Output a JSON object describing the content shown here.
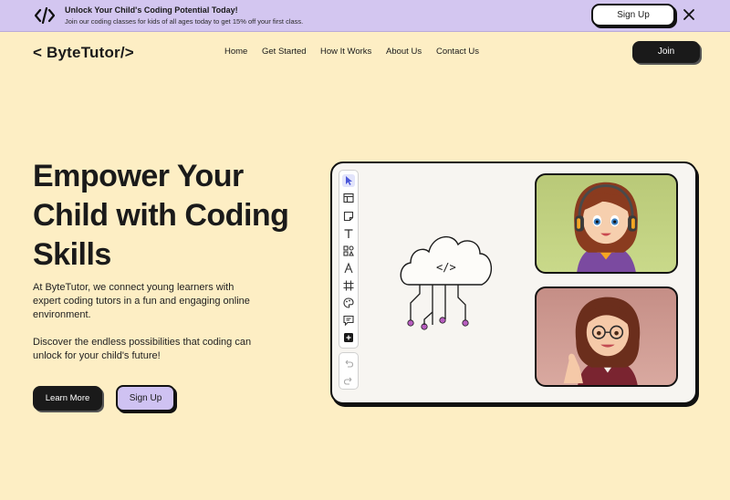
{
  "banner": {
    "icon": "code-brackets-icon",
    "title": "Unlock Your Child's Coding Potential Today!",
    "subtitle": "Join our coding classes for kids of all ages today to get 15% off your first class.",
    "signup_label": "Sign Up",
    "close_icon": "close-icon"
  },
  "header": {
    "logo": "< ByteTutor/>",
    "nav": [
      "Home",
      "Get Started",
      "How It Works",
      "About Us",
      "Contact Us"
    ],
    "join_label": "Join"
  },
  "hero": {
    "title": "Empower Your Child with Coding Skills",
    "paragraph1": "At ByteTutor, we connect young learners with expert coding tutors in a fun and engaging online environment.",
    "paragraph2": "Discover the endless possibilities that coding can unlock for your child's future!",
    "learn_more_label": "Learn More",
    "signup_label": "Sign Up"
  },
  "illustration": {
    "cloud_code": "</>",
    "tools": [
      "cursor-icon",
      "table-icon",
      "sticky-note-icon",
      "text-icon",
      "shapes-icon",
      "pen-icon",
      "frame-icon",
      "palette-icon",
      "comment-icon",
      "add-icon"
    ],
    "history_tools": [
      "undo-icon",
      "redo-icon"
    ],
    "photos": [
      "student-avatar-photo",
      "tutor-avatar-photo"
    ]
  },
  "colors": {
    "background": "#fdeec4",
    "banner": "#d3c6f0",
    "primary_dark": "#1a1a1a",
    "accent_purple": "#cfc2f2",
    "node_purple": "#b75dbf"
  }
}
